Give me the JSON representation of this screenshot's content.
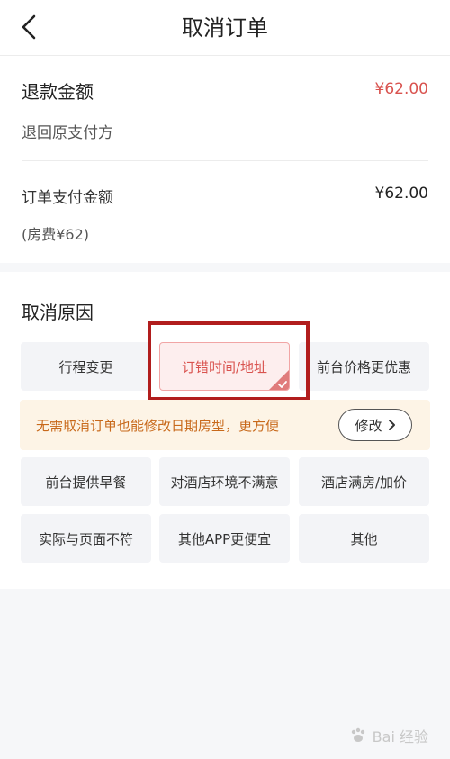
{
  "header": {
    "title": "取消订单",
    "back_icon": "chevron-left-icon"
  },
  "refund": {
    "label": "退款金额",
    "amount": "¥62.00",
    "method": "退回原支付方",
    "amount_color": "#d9534f"
  },
  "payment": {
    "label": "订单支付金额",
    "amount": "¥62.00",
    "room_fee": "(房费¥62)"
  },
  "reasons": {
    "title": "取消原因",
    "options": [
      {
        "label": "行程变更",
        "selected": false
      },
      {
        "label": "订错时间/地址",
        "selected": true
      },
      {
        "label": "前台价格更优惠",
        "selected": false
      },
      {
        "label": "前台提供早餐",
        "selected": false
      },
      {
        "label": "对酒店环境不满意",
        "selected": false
      },
      {
        "label": "酒店满房/加价",
        "selected": false
      },
      {
        "label": "实际与页面不符",
        "selected": false
      },
      {
        "label": "其他APP更便宜",
        "selected": false
      },
      {
        "label": "其他",
        "selected": false
      }
    ]
  },
  "tip": {
    "text": "无需取消订单也能修改日期房型，更方便",
    "button_label": "修改",
    "button_icon": "chevron-right-icon",
    "text_color": "#c8691b",
    "background": "#fdf4e6"
  },
  "watermark": {
    "text": "Bai 经验",
    "icon": "paw-icon"
  }
}
